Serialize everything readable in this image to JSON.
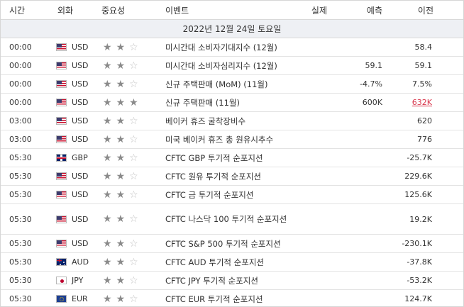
{
  "header": {
    "time": "시간",
    "currency": "외화",
    "importance": "중요성",
    "event": "이벤트",
    "actual": "실제",
    "forecast": "예측",
    "previous": "이전"
  },
  "date_label": "2022년 12월 24일 토요일",
  "rows": [
    {
      "time": "00:00",
      "flag": "us-flag-icon",
      "currency": "USD",
      "stars": 2,
      "event": "미시간대 소비자기대지수 (12월)",
      "actual": "",
      "forecast": "",
      "previous": "58.4"
    },
    {
      "time": "00:00",
      "flag": "us-flag-icon",
      "currency": "USD",
      "stars": 2,
      "event": "미시간대 소비자심리지수 (12월)",
      "actual": "",
      "forecast": "59.1",
      "previous": "59.1"
    },
    {
      "time": "00:00",
      "flag": "us-flag-icon",
      "currency": "USD",
      "stars": 2,
      "event": "신규 주택판매 (MoM) (11월)",
      "actual": "",
      "forecast": "-4.7%",
      "previous": "7.5%"
    },
    {
      "time": "00:00",
      "flag": "us-flag-icon",
      "currency": "USD",
      "stars": 3,
      "event": "신규 주택판매 (11월)",
      "actual": "",
      "forecast": "600K",
      "previous": "632K",
      "previous_revised": true
    },
    {
      "time": "03:00",
      "flag": "us-flag-icon",
      "currency": "USD",
      "stars": 2,
      "event": "베이커 휴즈 굴착장비수",
      "actual": "",
      "forecast": "",
      "previous": "620"
    },
    {
      "time": "03:00",
      "flag": "us-flag-icon",
      "currency": "USD",
      "stars": 2,
      "event": "미국 베이커 휴즈 총 원유시추수",
      "actual": "",
      "forecast": "",
      "previous": "776"
    },
    {
      "time": "05:30",
      "flag": "gb-flag-icon",
      "currency": "GBP",
      "stars": 2,
      "event": "CFTC GBP 투기적 순포지션",
      "actual": "",
      "forecast": "",
      "previous": "-25.7K"
    },
    {
      "time": "05:30",
      "flag": "us-flag-icon",
      "currency": "USD",
      "stars": 2,
      "event": "CFTC 원유 투기적 순포지션",
      "actual": "",
      "forecast": "",
      "previous": "229.6K"
    },
    {
      "time": "05:30",
      "flag": "us-flag-icon",
      "currency": "USD",
      "stars": 2,
      "event": "CFTC 금 투기적 순포지션",
      "actual": "",
      "forecast": "",
      "previous": "125.6K"
    },
    {
      "time": "05:30",
      "flag": "us-flag-icon",
      "currency": "USD",
      "stars": 2,
      "event": "CFTC 나스닥 100 투기적 순포지션",
      "actual": "",
      "forecast": "",
      "previous": "19.2K",
      "tall": true
    },
    {
      "time": "05:30",
      "flag": "us-flag-icon",
      "currency": "USD",
      "stars": 2,
      "event": "CFTC S&P 500 투기적 순포지션",
      "actual": "",
      "forecast": "",
      "previous": "-230.1K"
    },
    {
      "time": "05:30",
      "flag": "au-flag-icon",
      "currency": "AUD",
      "stars": 2,
      "event": "CFTC AUD 투기적 순포지션",
      "actual": "",
      "forecast": "",
      "previous": "-37.8K"
    },
    {
      "time": "05:30",
      "flag": "jp-flag-icon",
      "currency": "JPY",
      "stars": 2,
      "event": "CFTC JPY 투기적 순포지션",
      "actual": "",
      "forecast": "",
      "previous": "-53.2K"
    },
    {
      "time": "05:30",
      "flag": "eu-flag-icon",
      "currency": "EUR",
      "stars": 2,
      "event": "CFTC EUR 투기적 순포지션",
      "actual": "",
      "forecast": "",
      "previous": "124.7K"
    }
  ],
  "colors": {
    "revised_value": "#d8354b",
    "date_band": "#eef0f4",
    "star_on": "#8a8a8a",
    "star_off": "#c4c4c4"
  }
}
